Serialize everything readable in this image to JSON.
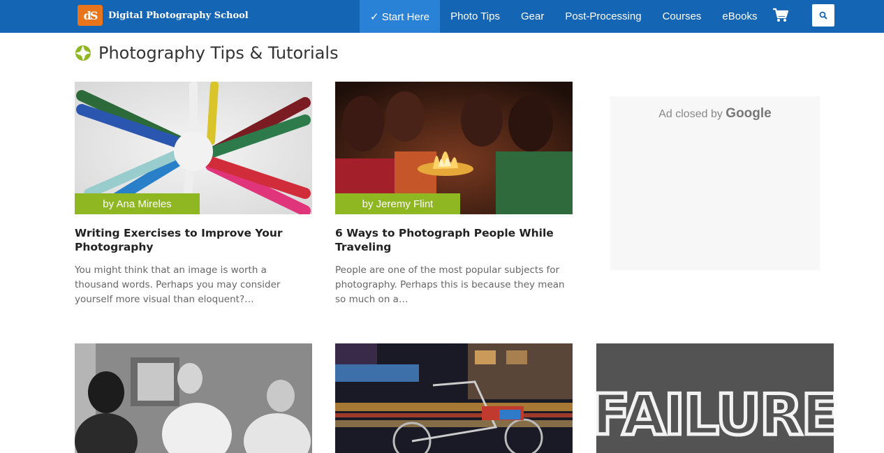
{
  "header": {
    "logo_mark": "dS",
    "site_name": "Digital Photography School",
    "nav": [
      {
        "label": "✓ Start Here",
        "active": true
      },
      {
        "label": "Photo Tips"
      },
      {
        "label": "Gear"
      },
      {
        "label": "Post-Processing"
      },
      {
        "label": "Courses"
      },
      {
        "label": "eBooks"
      }
    ],
    "cart_icon": "shopping-cart-icon",
    "search_icon": "search-icon"
  },
  "page": {
    "title": "Photography Tips & Tutorials",
    "title_icon": "aperture-icon"
  },
  "articles": [
    {
      "author": "by Ana Mireles",
      "title": "Writing Exercises to Improve Your Photography",
      "excerpt": "You might think that an image is worth a thousand words. Perhaps you may consider yourself more visual than eloquent?…"
    },
    {
      "author": "by Jeremy Flint",
      "title": "6 Ways to Photograph People While Traveling",
      "excerpt": "People are one of the most popular subjects for photography. Perhaps this is because they mean so much on a…"
    }
  ],
  "ad": {
    "closed_text": "Ad closed by",
    "brand": "Google"
  },
  "thumbs": [
    {
      "name": "photographers-bw-thumb"
    },
    {
      "name": "night-street-thumb"
    },
    {
      "name": "failure-chalkboard-thumb",
      "caption": "FAILURE"
    }
  ],
  "colors": {
    "header_bg": "#1565b5",
    "nav_active_bg": "#2a82d6",
    "author_badge": "#8fb721",
    "logo_orange": "#e8751c"
  }
}
